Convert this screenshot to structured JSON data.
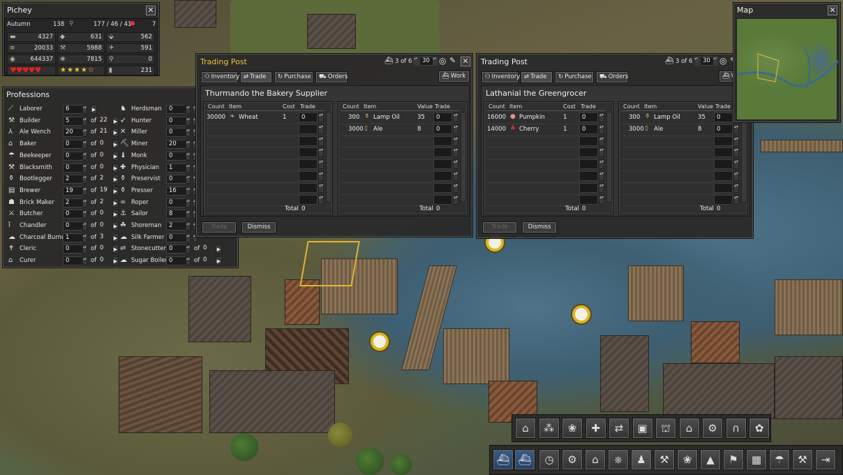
{
  "settlement": {
    "name": "Pichey",
    "season": "Autumn",
    "year": "138",
    "population": "177 / 46 / 41",
    "health": "7",
    "resources": [
      {
        "icon": "log-icon",
        "value": "4327"
      },
      {
        "icon": "stone-icon",
        "value": "631"
      },
      {
        "icon": "iron-icon",
        "value": "562"
      },
      {
        "icon": "firewood-icon",
        "value": "20033"
      },
      {
        "icon": "tools-icon",
        "value": "5988"
      },
      {
        "icon": "coal-icon",
        "value": "591"
      },
      {
        "icon": "gold-icon",
        "value": "644337"
      },
      {
        "icon": "food-icon",
        "value": "7815"
      },
      {
        "icon": "torch-icon",
        "value": "0"
      },
      {
        "icon": "hearts-icon",
        "value": "♥♥♥♥♥"
      },
      {
        "icon": "stars-icon",
        "value": "★★★★☆"
      },
      {
        "icon": "barrel-icon",
        "value": "231"
      }
    ]
  },
  "professions": {
    "title": "Professions",
    "left": [
      {
        "icon": "laborer-icon",
        "name": "Laborer",
        "value": "6",
        "max": ""
      },
      {
        "icon": "builder-icon",
        "name": "Builder",
        "value": "5",
        "max": "22"
      },
      {
        "icon": "ale-wench-icon",
        "name": "Ale Wench",
        "value": "20",
        "max": "21"
      },
      {
        "icon": "baker-icon",
        "name": "Baker",
        "value": "0",
        "max": "0"
      },
      {
        "icon": "beekeeper-icon",
        "name": "Beekeeper",
        "value": "0",
        "max": "0"
      },
      {
        "icon": "blacksmith-icon",
        "name": "Blacksmith",
        "value": "0",
        "max": "0"
      },
      {
        "icon": "bootlegger-icon",
        "name": "Bootlegger",
        "value": "2",
        "max": "2"
      },
      {
        "icon": "brewer-icon",
        "name": "Brewer",
        "value": "19",
        "max": "19"
      },
      {
        "icon": "brick-maker-icon",
        "name": "Brick Maker",
        "value": "2",
        "max": "2"
      },
      {
        "icon": "butcher-icon",
        "name": "Butcher",
        "value": "0",
        "max": "0"
      },
      {
        "icon": "chandler-icon",
        "name": "Chandler",
        "value": "0",
        "max": "0"
      },
      {
        "icon": "charcoal-burner-icon",
        "name": "Charcoal Burner",
        "value": "1",
        "max": "3"
      },
      {
        "icon": "cleric-icon",
        "name": "Cleric",
        "value": "0",
        "max": "0"
      },
      {
        "icon": "curer-icon",
        "name": "Curer",
        "value": "0",
        "max": "0"
      }
    ],
    "right": [
      {
        "icon": "herdsman-icon",
        "name": "Herdsman",
        "value": "0",
        "max": ""
      },
      {
        "icon": "hunter-icon",
        "name": "Hunter",
        "value": "0",
        "max": ""
      },
      {
        "icon": "miller-icon",
        "name": "Miller",
        "value": "0",
        "max": ""
      },
      {
        "icon": "miner-icon",
        "name": "Miner",
        "value": "20",
        "max": ""
      },
      {
        "icon": "monk-icon",
        "name": "Monk",
        "value": "0",
        "max": ""
      },
      {
        "icon": "physician-icon",
        "name": "Physician",
        "value": "1",
        "max": ""
      },
      {
        "icon": "preservist-icon",
        "name": "Preservist",
        "value": "0",
        "max": ""
      },
      {
        "icon": "presser-icon",
        "name": "Presser",
        "value": "16",
        "max": ""
      },
      {
        "icon": "roper-icon",
        "name": "Roper",
        "value": "0",
        "max": ""
      },
      {
        "icon": "sailor-icon",
        "name": "Sailor",
        "value": "8",
        "max": ""
      },
      {
        "icon": "shoreman-icon",
        "name": "Shoreman",
        "value": "2",
        "max": ""
      },
      {
        "icon": "silk-farmer-icon",
        "name": "Silk Farmer",
        "value": "0",
        "max": ""
      },
      {
        "icon": "stonecutter-icon",
        "name": "Stonecutter",
        "value": "0",
        "max": "0"
      },
      {
        "icon": "sugar-boiler-icon",
        "name": "Sugar Boiler",
        "value": "0",
        "max": "0"
      }
    ],
    "of": "of"
  },
  "trading_posts": [
    {
      "title": "Trading Post",
      "page": "3 of 6",
      "amount": "30",
      "tabs": [
        "Inventory",
        "Trade",
        "Purchase",
        "Orders"
      ],
      "work": "Work",
      "merchant": "Thurmando the Bakery Supplier",
      "sell_headers": [
        "Count",
        "Item",
        "Cost",
        "Trade"
      ],
      "sell_rows": [
        {
          "count": "30000",
          "item": "Wheat",
          "icon": "wheat-icon",
          "price": "1",
          "trade": "0"
        }
      ],
      "buy_headers": [
        "Count",
        "Item",
        "Value",
        "Trade"
      ],
      "buy_rows": [
        {
          "count": "300",
          "item": "Lamp Oil",
          "icon": "lamp-oil-icon",
          "price": "35",
          "trade": "0"
        },
        {
          "count": "3000",
          "item": "Ale",
          "icon": "ale-icon",
          "price": "8",
          "trade": "0"
        }
      ],
      "total_label": "Total",
      "sell_total": "0",
      "buy_total": "0",
      "trade_btn": "Trade",
      "dismiss_btn": "Dismiss"
    },
    {
      "title": "Trading Post",
      "page": "3 of 6",
      "amount": "30",
      "tabs": [
        "Inventory",
        "Trade",
        "Purchase",
        "Orders"
      ],
      "work": "Work",
      "merchant": "Lathanial the Greengrocer",
      "sell_headers": [
        "Count",
        "Item",
        "Cost",
        "Trade"
      ],
      "sell_rows": [
        {
          "count": "16000",
          "item": "Pumpkin",
          "icon": "pumpkin-icon",
          "price": "1",
          "trade": "0"
        },
        {
          "count": "14000",
          "item": "Cherry",
          "icon": "cherry-icon",
          "price": "1",
          "trade": "0"
        }
      ],
      "buy_headers": [
        "Count",
        "Item",
        "Value",
        "Trade"
      ],
      "buy_rows": [
        {
          "count": "300",
          "item": "Lamp Oil",
          "icon": "lamp-oil-icon",
          "price": "35",
          "trade": "0"
        },
        {
          "count": "3000",
          "item": "Ale",
          "icon": "ale-icon",
          "price": "8",
          "trade": "0"
        }
      ],
      "total_label": "Total",
      "sell_total": "0",
      "buy_total": "0",
      "trade_btn": "Trade",
      "dismiss_btn": "Dismiss"
    }
  ],
  "map": {
    "title": "Map"
  },
  "toolbar": {
    "build_row": [
      "house-icon",
      "storage-icon",
      "food-production-icon",
      "health-icon",
      "trade-icon",
      "resource-icon",
      "barn-icon",
      "town-hall-icon",
      "industry-icon",
      "bridge-icon",
      "decoration-icon"
    ],
    "main_row": [
      "boat-icon",
      "boat2-icon",
      "clock-icon",
      "settings-icon",
      "town-icon",
      "wheel-icon",
      "professions-icon",
      "build-icon",
      "food-icon",
      "drop-icon",
      "resources-icon",
      "grid-icon",
      "market-icon",
      "tools-icon",
      "exit-icon"
    ]
  }
}
